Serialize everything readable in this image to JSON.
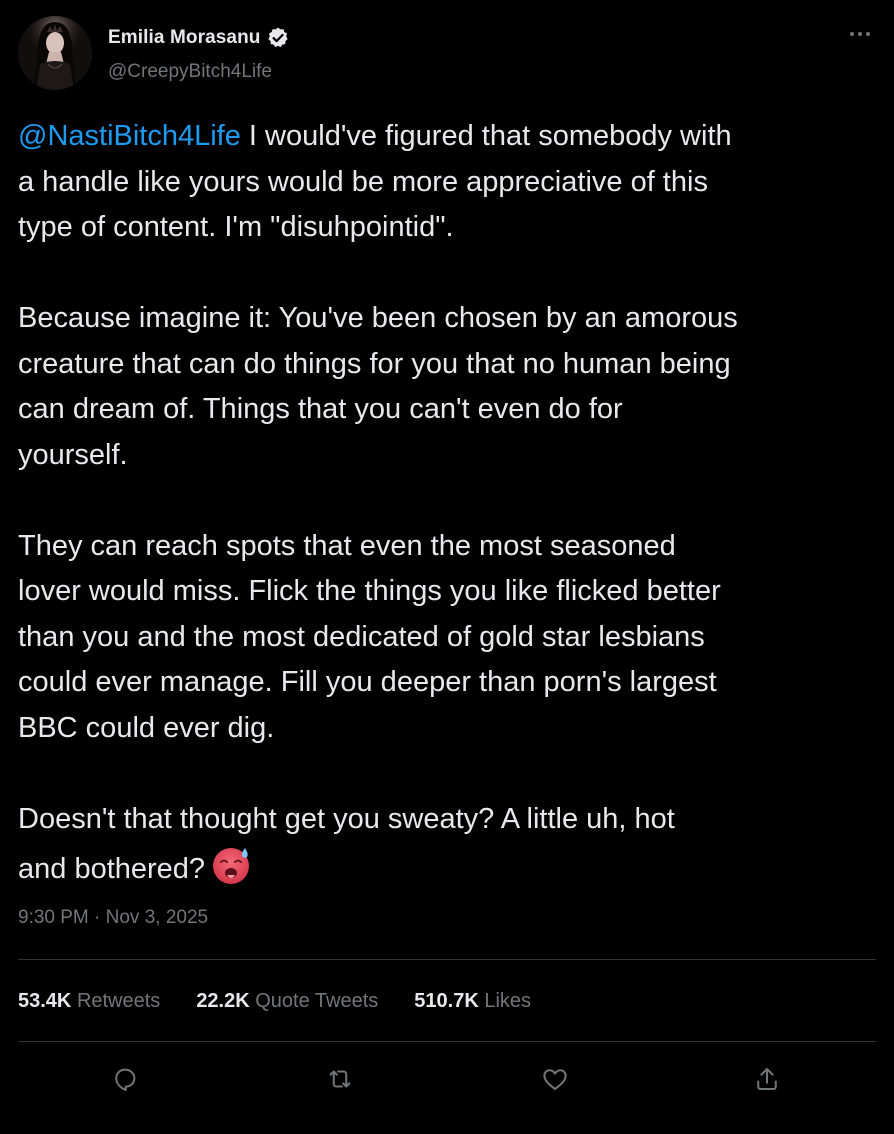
{
  "author": {
    "display_name": "Emilia Morasanu",
    "handle": "@CreepyBitch4Life",
    "verified": true
  },
  "tweet": {
    "mention": "@NastiBitch4Life",
    "paragraph_1": " I would've figured that somebody with\na handle like yours would be more appreciative of this\ntype of content. I'm \"disuhpointid\".",
    "paragraph_2": "Because imagine it: You've been chosen by an amorous\ncreature that can do things for you that no human being\ncan dream of. Things that you can't even do for\nyourself.",
    "paragraph_3": "They can reach spots that even the most seasoned\nlover would miss. Flick the things you like flicked better\nthan you and the most dedicated of gold star lesbians\ncould ever manage. Fill you deeper than porn's largest\nBBC could ever dig.",
    "paragraph_4": "Doesn't that thought get you sweaty? A little uh, hot\nand bothered?",
    "emoji": "hot-face-emoji"
  },
  "meta": {
    "timestamp": "9:30 PM · Nov 3, 2025"
  },
  "stats": {
    "retweets_count": "53.4K",
    "retweets_label": "Retweets",
    "quotes_count": "22.2K",
    "quotes_label": "Quote Tweets",
    "likes_count": "510.7K",
    "likes_label": "Likes"
  },
  "actions": {
    "icons": [
      "reply-icon",
      "retweet-icon",
      "like-icon",
      "share-icon"
    ]
  },
  "colors": {
    "background": "#000000",
    "text": "#e7e9ea",
    "muted": "#71767b",
    "link": "#1d9bf0",
    "divider": "#2f3336"
  }
}
